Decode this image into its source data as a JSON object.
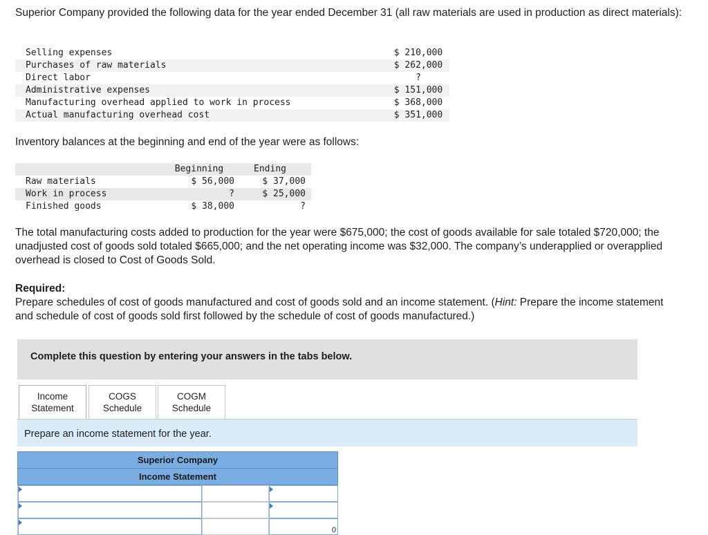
{
  "intro": "Superior Company provided the following data for the year ended December 31 (all raw materials are used in production as direct materials):",
  "data_items": [
    {
      "label": "Selling expenses",
      "value": "$ 210,000"
    },
    {
      "label": "Purchases of raw materials",
      "value": "$ 262,000"
    },
    {
      "label": "Direct labor",
      "value": "?"
    },
    {
      "label": "Administrative expenses",
      "value": "$ 151,000"
    },
    {
      "label": "Manufacturing overhead applied to work in process",
      "value": "$ 368,000"
    },
    {
      "label": "Actual manufacturing overhead cost",
      "value": "$ 351,000"
    }
  ],
  "inventory_intro": "Inventory balances at the beginning and end of the year were as follows:",
  "inventory": {
    "col_beginning": "Beginning",
    "col_ending": "Ending",
    "rows": [
      {
        "label": "Raw materials",
        "beginning": "$ 56,000",
        "ending": "$ 37,000"
      },
      {
        "label": "Work in process",
        "beginning": "?",
        "ending": "$ 25,000"
      },
      {
        "label": "Finished goods",
        "beginning": "$ 38,000",
        "ending": "?"
      }
    ]
  },
  "totals_paragraph": "The total manufacturing costs added to production for the year were $675,000; the cost of goods available for sale totaled $720,000; the unadjusted cost of goods sold totaled $665,000; and the net operating income was $32,000. The company’s underapplied or overapplied overhead is closed to Cost of Goods Sold.",
  "required_label": "Required:",
  "required_text_1": "Prepare schedules of cost of goods manufactured and cost of goods sold and an income statement. (",
  "required_hint_label": "Hint:",
  "required_text_2": " Prepare the income statement and schedule of cost of goods sold first followed by the schedule of cost of goods manufactured.)",
  "complete_box": "Complete this question by entering your answers in the tabs below.",
  "tabs": [
    {
      "line1": "Income",
      "line2": "Statement"
    },
    {
      "line1": "COGS",
      "line2": "Schedule"
    },
    {
      "line1": "COGM",
      "line2": "Schedule"
    }
  ],
  "prompt": "Prepare an income statement for the year.",
  "statement": {
    "company": "Superior Company",
    "title": "Income Statement",
    "last_value": "0"
  }
}
